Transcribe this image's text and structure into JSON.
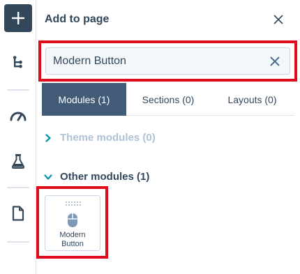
{
  "sidebar": {
    "add_icon": "plus-icon",
    "items": [
      {
        "icon": "tree-structure-icon"
      },
      {
        "icon": "speedometer-icon"
      },
      {
        "icon": "flask-icon"
      },
      {
        "icon": "document-icon"
      }
    ]
  },
  "panel": {
    "title": "Add to page",
    "close_icon": "close-icon"
  },
  "search": {
    "value": "Modern Button",
    "clear_icon": "clear-x-icon"
  },
  "tabs": [
    {
      "label": "Modules (1)",
      "active": true
    },
    {
      "label": "Sections (0)",
      "active": false
    },
    {
      "label": "Layouts (0)",
      "active": false
    }
  ],
  "groups": {
    "theme": {
      "label": "Theme modules (0)",
      "expanded": false
    },
    "other": {
      "label": "Other modules (1)",
      "expanded": true
    }
  },
  "modules": [
    {
      "name": "Modern\nButton",
      "icon": "mouse-icon"
    }
  ],
  "colors": {
    "accent_dark": "#33475b",
    "active_tab": "#425b76",
    "teal_chevron": "#0091ae",
    "highlight_red": "#e00b1c"
  }
}
